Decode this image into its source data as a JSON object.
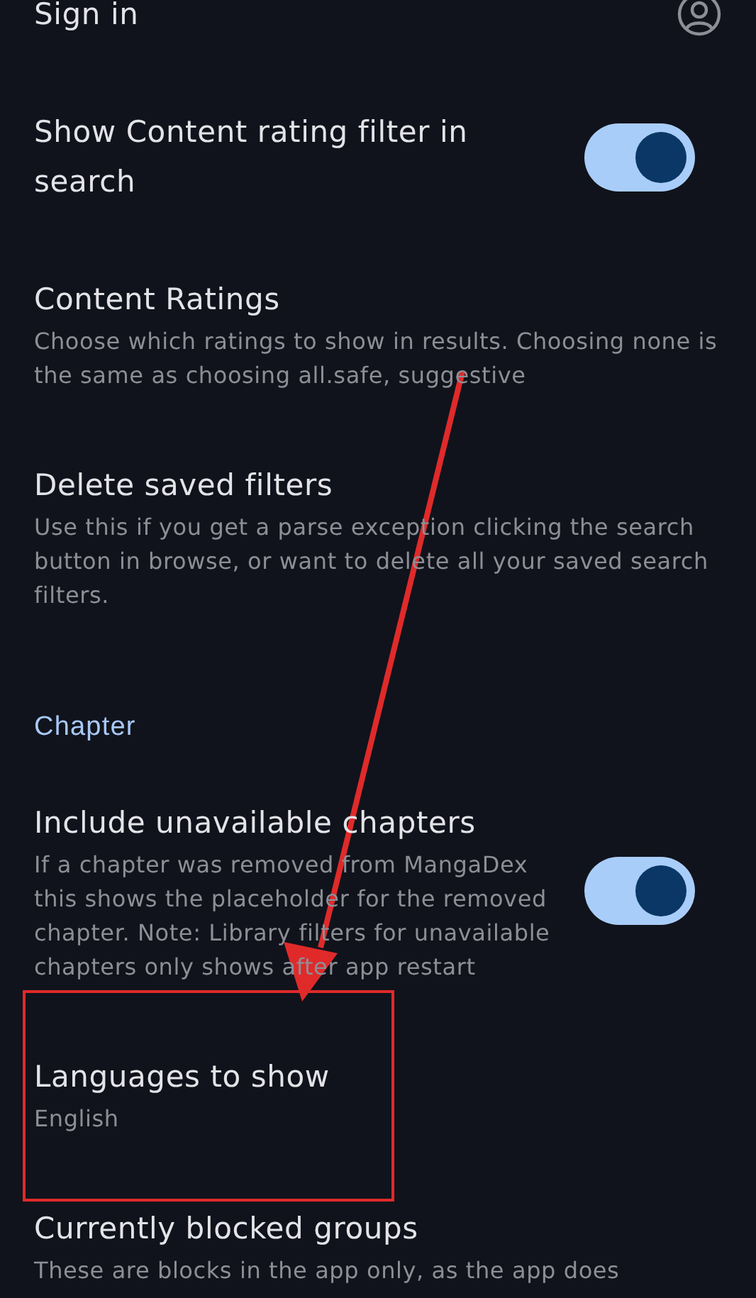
{
  "settings": [
    {
      "kind": "account",
      "title": "Sign in"
    },
    {
      "kind": "switch",
      "title": "Show Content rating filter in search",
      "on": true
    },
    {
      "kind": "text",
      "title": "Content Ratings",
      "summary": "Choose which ratings to show in results. Choosing none is the same as choosing all.safe, suggestive"
    },
    {
      "kind": "text",
      "title": "Delete saved filters",
      "summary": "Use this if you get a parse exception clicking the search button in browse, or want to delete all your saved search filters."
    },
    {
      "kind": "header",
      "title": "Chapter"
    },
    {
      "kind": "switch",
      "title": "Include unavailable chapters",
      "summary": "If a chapter was removed from MangaDex this shows the placeholder for the removed chapter. Note: Library filters for unavailable chapters only shows after app restart",
      "on": true
    },
    {
      "kind": "text",
      "title": "Languages to show",
      "summary": "English",
      "highlighted": true
    },
    {
      "kind": "text",
      "title": "Currently blocked groups",
      "summary": "These are blocks in the app only, as the app does"
    }
  ]
}
